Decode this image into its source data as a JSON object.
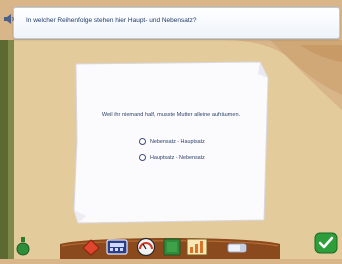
{
  "question_bar": {
    "text": "In welcher Reihenfolge stehen hier Haupt- und Nebensatz?"
  },
  "card": {
    "sentence": "Weil ihr niemand half, musste Mutter alleine aufräumen.",
    "options": [
      {
        "label": "Nebensatz - Hauptsatz",
        "selected": false
      },
      {
        "label": "Hauptsatz - Nebensatz",
        "selected": false
      }
    ]
  },
  "toolbar": {
    "icons": [
      "potion-icon",
      "red-diamond-icon",
      "calculator-icon",
      "speedometer-icon",
      "green-book-icon",
      "bar-chart-icon",
      "brush-icon",
      "checkmark-icon"
    ]
  },
  "colors": {
    "sky": "#d9b58a",
    "ground": "#e6cfa0",
    "wood": "#8b4a1e",
    "accent_blue": "#243a6b",
    "ok_green": "#2e9e3a"
  }
}
